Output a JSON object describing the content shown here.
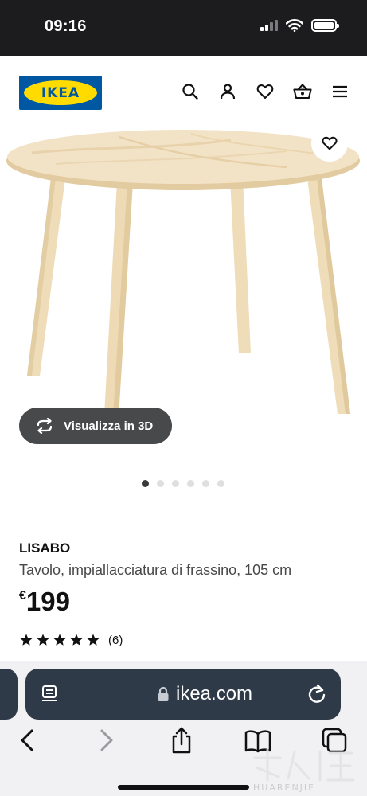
{
  "status_bar": {
    "time": "09:16",
    "icons": [
      "signal-icon",
      "wifi-icon",
      "battery-icon"
    ]
  },
  "header": {
    "logo_text": "IKEA",
    "icons": [
      "search-icon",
      "account-icon",
      "heart-icon",
      "basket-icon",
      "menu-icon"
    ]
  },
  "gallery": {
    "view_3d_label": "Visualizza in 3D",
    "slide_count": 6,
    "active_slide": 1
  },
  "product": {
    "name": "LISABO",
    "description": "Tavolo, impiallacciatura di frassino,",
    "size": "105 cm",
    "price_currency": "€",
    "price_value": "199",
    "rating": 5,
    "rating_max": 5,
    "review_count": "(6)"
  },
  "browser": {
    "url": "ikea.com",
    "icons": [
      "reader-icon",
      "lock-icon",
      "reload-icon",
      "back-icon",
      "forward-icon",
      "share-icon",
      "bookmarks-icon",
      "tabs-icon"
    ]
  },
  "watermark": {
    "text": "HUARENJIE"
  },
  "colors": {
    "ikea_blue": "#0058a3",
    "ikea_yellow": "#ffdb00",
    "status_bar_bg": "#1c1c1e",
    "url_bar_bg": "#2f3a48",
    "table_wood": "#f2e1c1"
  }
}
